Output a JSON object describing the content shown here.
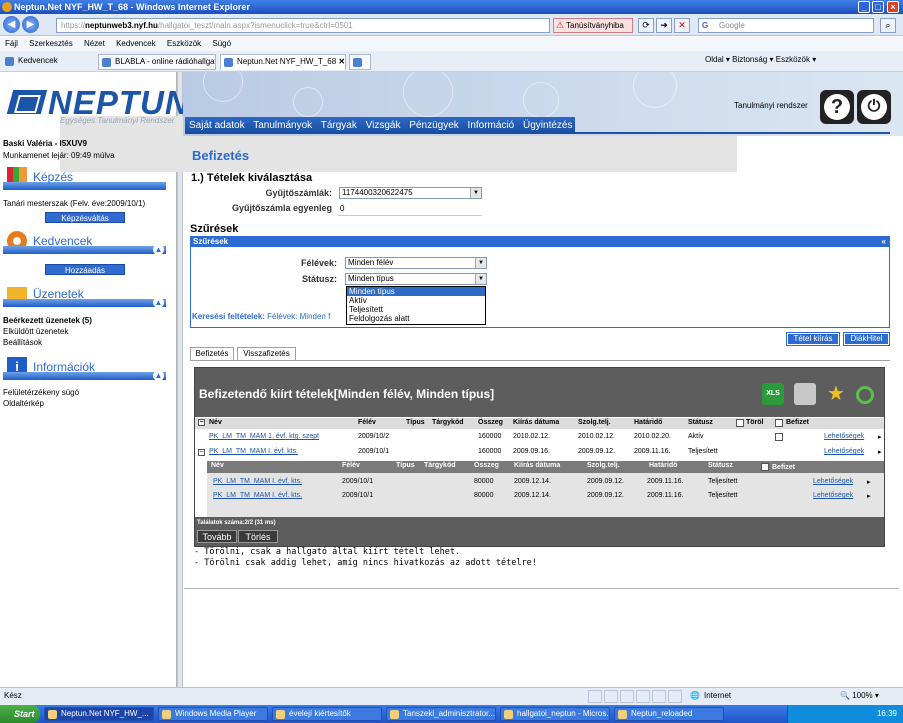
{
  "window": {
    "title": "Neptun.Net NYF_HW_T_68 - Windows Internet Explorer",
    "url_prefix": "https://",
    "url_host": "neptunweb3.nyf.hu",
    "url_path": "/hallgatoi_teszt/main.aspx?ismenuclick=true&ctrl=0501",
    "cert_error": "Tanúsítványhiba",
    "search_placeholder": "Google"
  },
  "menubar": [
    "Fájl",
    "Szerkesztés",
    "Nézet",
    "Kedvencek",
    "Eszközök",
    "Súgó"
  ],
  "tabs": {
    "favorites": "Kedvencek",
    "tab1": "BLABLA - online rádióhallgat...",
    "tab2": "Neptun.Net NYF_HW_T_68",
    "right_tools": "Oldal ▾  Biztonság ▾  Eszközök ▾"
  },
  "logo": {
    "name": "NEPTUN",
    "tagline": "Egységes Tanulmányi Rendszer"
  },
  "sidebar": {
    "user": "Baski Valéria - I5XUV9",
    "session": "Munkamenet lejár: 09:49 múlva",
    "kepzes_title": "Képzés",
    "kepzes_value": "Tanári mesterszak (Felv. éve:2009/10/1)",
    "kepzes_button": "Képzésváltás",
    "kedvencek_title": "Kedvencek",
    "kedvencek_button": "Hozzáadás",
    "uzenetek_title": "Üzenetek",
    "uzenetek_items": [
      "Beérkezett üzenetek (5)",
      "Elküldött üzenetek",
      "Beállítások"
    ],
    "info_title": "Információk",
    "info_items": [
      "Felületérzékeny súgó",
      "Oldaltérkép"
    ]
  },
  "header": {
    "system_label": "Tanulmányi rendszer",
    "nav": [
      "Saját adatok",
      "Tanulmányok",
      "Tárgyak",
      "Vizsgák",
      "Pénzügyek",
      "Információ",
      "Ügyintézés"
    ]
  },
  "page": {
    "title": "Befizetés",
    "step1": "1.) Tételek kiválasztása",
    "gyujto_label": "Gyűjtőszámlák:",
    "gyujto_value": "1174400320622475",
    "egyenleg_label": "Gyűjtőszámla egyenleg",
    "egyenleg_value": "0",
    "szuresek_title": "Szűrések",
    "szuresek_head": "Szűrések",
    "felevek_label": "Félévek:",
    "felevek_value": "Minden félév",
    "statusz_label": "Státusz:",
    "statusz_value": "Minden típus",
    "statusz_options": [
      "Minden típus",
      "Aktív",
      "Teljesített",
      "Feldolgozás alatt"
    ],
    "keresesi_label": "Keresési feltételek:",
    "keresesi_value": "Félévek: Minden f",
    "btn_tetel": "Tétel kiírás",
    "btn_diak": "DiákHitel",
    "subtab_befizetes": "Befizetés",
    "subtab_vissza": "Visszafizetés"
  },
  "grid": {
    "title": "Befizetendő kiírt tételek[Minden félév, Minden típus]",
    "columns": [
      "Név",
      "Félév",
      "Típus",
      "Tárgykód",
      "Összeg",
      "Kiírás dátuma",
      "Szolg.telj.",
      "Határidő",
      "Státusz",
      "Töröl",
      "Befizet"
    ],
    "rows": [
      {
        "nev": "PK_LM_TM_MAM 1. évf. ktg. szept",
        "felev": "2009/10/2",
        "osszeg": "160000",
        "kiiras": "2010.02.12.",
        "szolg": "2010.02.12.",
        "hatarido": "2010.02.20.",
        "statusz": "Aktív",
        "lehet": "Lehetőségek"
      },
      {
        "nev": "PK_LM_TM_MAM I. évf. kts.",
        "felev": "2009/10/1",
        "osszeg": "160000",
        "kiiras": "2009.09.16.",
        "szolg": "2009.09.12.",
        "hatarido": "2009.11.16.",
        "statusz": "Teljesített",
        "lehet": "Lehetőségek"
      }
    ],
    "sub_columns": [
      "Név",
      "Félév",
      "Típus",
      "Tárgykód",
      "Összeg",
      "Kiírás dátuma",
      "Szolg.telj.",
      "Határidő",
      "Státusz",
      "Befizet"
    ],
    "sub_rows": [
      {
        "nev": "PK_LM_TM_MAM I. évf. kts.",
        "felev": "2009/10/1",
        "osszeg": "80000",
        "kiiras": "2009.12.14.",
        "szolg": "2009.09.12.",
        "hatarido": "2009.11.16.",
        "statusz": "Teljesített",
        "lehet": "Lehetőségek"
      },
      {
        "nev": "PK_LM_TM_MAM I. évf. kts.",
        "felev": "2009/10/1",
        "osszeg": "80000",
        "kiiras": "2009.12.14.",
        "szolg": "2009.09.12.",
        "hatarido": "2009.11.16.",
        "statusz": "Teljesített",
        "lehet": "Lehetőségek"
      }
    ],
    "found": "Találatok száma:2/2 (31 ms)",
    "btn_tovabb": "Tovább",
    "btn_torles": "Törlés"
  },
  "notes": [
    "- Törölni, csak a hallgató által kiírt tételt lehet.",
    "- Törölni csak addig lehet, amíg nincs hivatkozás az adott tételre!"
  ],
  "status": {
    "left": "Kész",
    "zone": "Internet",
    "zoom": "100%"
  },
  "taskbar": {
    "start": "Start",
    "items": [
      "Neptun.Net NYF_HW_...",
      "Windows Media Player",
      "évelejí kiértesítők",
      "Tanszeki_adminisztrator...",
      "hallgatoi_neptun - Micros...",
      "Neptun_reloaded"
    ],
    "lang": "HU",
    "clock": "16:39"
  }
}
